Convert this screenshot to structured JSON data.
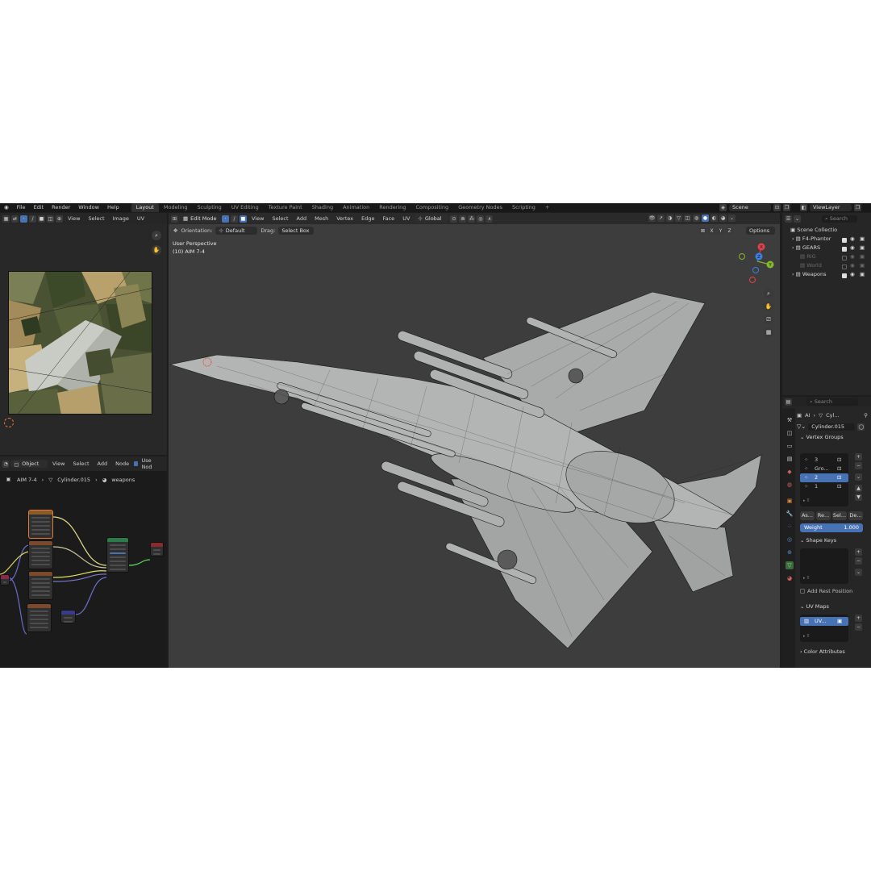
{
  "topbar": {
    "menus": [
      "File",
      "Edit",
      "Render",
      "Window",
      "Help"
    ],
    "workspaces": [
      "Layout",
      "Modeling",
      "Sculpting",
      "UV Editing",
      "Texture Paint",
      "Shading",
      "Animation",
      "Rendering",
      "Compositing",
      "Geometry Nodes",
      "Scripting"
    ],
    "add_tab": "+",
    "scene": "Scene",
    "view_layer": "ViewLayer"
  },
  "image_editor": {
    "menus": [
      "View",
      "Select",
      "Image",
      "UV"
    ]
  },
  "viewport": {
    "mode": "Edit Mode",
    "menus": [
      "View",
      "Select",
      "Add",
      "Mesh",
      "Vertex",
      "Edge",
      "Face",
      "UV"
    ],
    "transform_orientation": "Global",
    "orientation_label": "Orientation:",
    "orientation_value": "Default",
    "drag_label": "Drag:",
    "drag_value": "Select Box",
    "axes": [
      "X",
      "Y",
      "Z"
    ],
    "options": "Options",
    "perspective": "User Perspective",
    "object_info": "(10) AIM 7-4",
    "gizmo": {
      "x": "X",
      "y": "Y",
      "z": "Z"
    },
    "colors": {
      "x": "#e0424d",
      "y": "#83b72c",
      "z": "#3d7fe0"
    }
  },
  "node_editor": {
    "type": "Object",
    "menus": [
      "View",
      "Select",
      "Add",
      "Node"
    ],
    "use_nodes": "Use Nod",
    "breadcrumb": [
      "AIM 7-4",
      "Cylinder.015",
      "weapons"
    ]
  },
  "outliner": {
    "search_placeholder": "Search",
    "root": "Scene Collectio",
    "items": [
      {
        "name": "F4-Phantor",
        "enabled": true,
        "dim": false
      },
      {
        "name": "GEARS",
        "enabled": true,
        "dim": false
      },
      {
        "name": "RIG",
        "enabled": false,
        "dim": true
      },
      {
        "name": "World",
        "enabled": false,
        "dim": true
      },
      {
        "name": "Weapons",
        "enabled": true,
        "dim": false
      }
    ]
  },
  "properties": {
    "search_placeholder": "Search",
    "breadcrumb_obj": "AI",
    "breadcrumb_mesh": "Cyl...",
    "mesh_name": "Cylinder.015",
    "vertex_groups": {
      "title": "Vertex Groups",
      "items": [
        {
          "name": "3",
          "selected": false
        },
        {
          "name": "Gro...",
          "selected": false
        },
        {
          "name": "2",
          "selected": true
        },
        {
          "name": "1",
          "selected": false
        }
      ],
      "buttons": [
        "As...",
        "Re...",
        "Sel...",
        "De..."
      ],
      "weight_label": "Weight",
      "weight_value": "1.000"
    },
    "shape_keys": {
      "title": "Shape Keys",
      "add_rest": "Add Rest Position"
    },
    "uv_maps": {
      "title": "UV Maps",
      "item": "UV..."
    },
    "color_attributes": "Color Attributes"
  }
}
